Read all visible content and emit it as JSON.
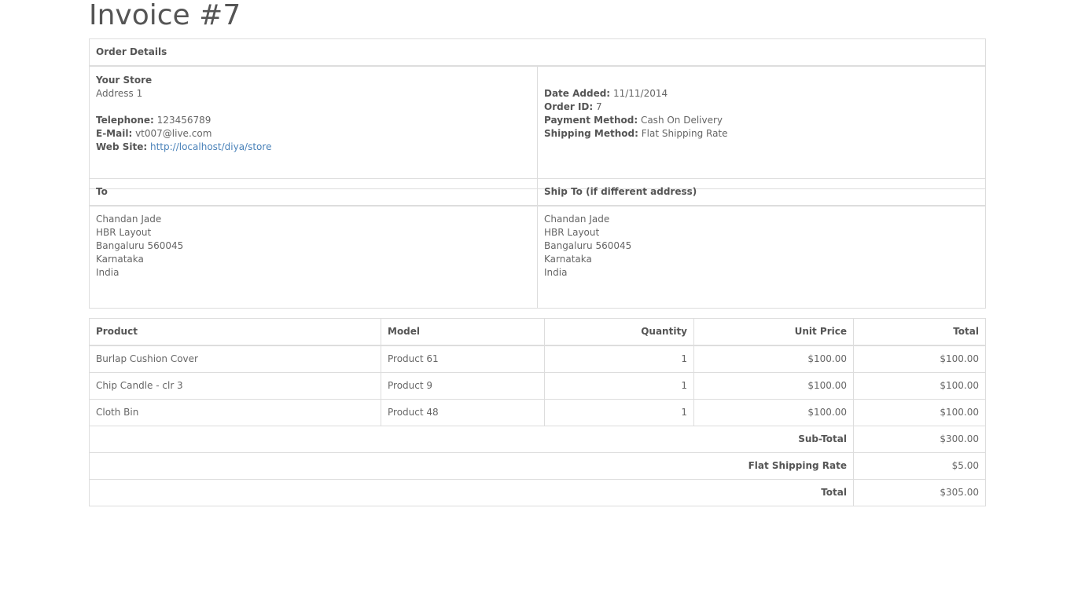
{
  "title": "Invoice #7",
  "order_details": {
    "header": "Order Details",
    "store": {
      "name": "Your Store",
      "address": "Address 1",
      "telephone_label": "Telephone:",
      "telephone": "123456789",
      "email_label": "E-Mail:",
      "email": "vt007@live.com",
      "website_label": "Web Site:",
      "website": "http://localhost/diya/store"
    },
    "info": {
      "date_added_label": "Date Added:",
      "date_added": "11/11/2014",
      "order_id_label": "Order ID:",
      "order_id": "7",
      "payment_method_label": "Payment Method:",
      "payment_method": "Cash On Delivery",
      "shipping_method_label": "Shipping Method:",
      "shipping_method": "Flat Shipping Rate"
    }
  },
  "addresses": {
    "to_header": "To",
    "ship_to_header": "Ship To (if different address)",
    "to": [
      "Chandan Jade",
      "HBR Layout",
      "Bangaluru 560045",
      "Karnataka",
      "India"
    ],
    "ship_to": [
      "Chandan Jade",
      "HBR Layout",
      "Bangaluru 560045",
      "Karnataka",
      "India"
    ]
  },
  "products": {
    "headers": [
      "Product",
      "Model",
      "Quantity",
      "Unit Price",
      "Total"
    ],
    "rows": [
      [
        "Burlap Cushion Cover",
        "Product 61",
        "1",
        "$100.00",
        "$100.00"
      ],
      [
        "Chip Candle - clr 3",
        "Product 9",
        "1",
        "$100.00",
        "$100.00"
      ],
      [
        "Cloth Bin",
        "Product 48",
        "1",
        "$100.00",
        "$100.00"
      ]
    ],
    "totals": [
      {
        "label": "Sub-Total",
        "value": "$300.00"
      },
      {
        "label": "Flat Shipping Rate",
        "value": "$5.00"
      },
      {
        "label": "Total",
        "value": "$305.00"
      }
    ]
  },
  "colors": {
    "text": "#666666",
    "link": "#4a82b9",
    "border": "#dddddd"
  }
}
